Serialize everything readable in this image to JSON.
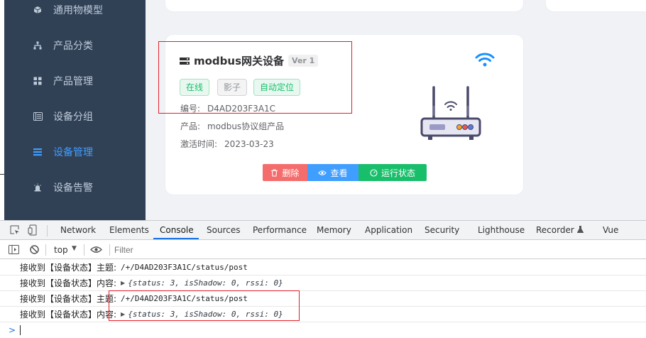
{
  "sidebar": {
    "items": [
      {
        "label": "通用物模型",
        "icon": "cube-icon",
        "active": false
      },
      {
        "label": "产品分类",
        "icon": "tree-icon",
        "active": false
      },
      {
        "label": "产品管理",
        "icon": "grid-icon",
        "active": false
      },
      {
        "label": "设备分组",
        "icon": "list-icon",
        "active": false
      },
      {
        "label": "设备管理",
        "icon": "device-list-icon",
        "active": true
      },
      {
        "label": "设备告警",
        "icon": "alarm-icon",
        "active": false
      }
    ]
  },
  "device_card": {
    "title": "modbus网关设备",
    "version": "Ver 1",
    "tags": [
      "在线",
      "影子",
      "自动定位"
    ],
    "serial_label": "编号:",
    "serial_value": "D4AD203F3A1C",
    "product_label": "产品:",
    "product_value": "modbus协议组产品",
    "activated_label": "激活时间:",
    "activated_value": "2023-03-23",
    "buttons": {
      "delete": "删除",
      "view": "查看",
      "status": "运行状态"
    }
  },
  "devtools": {
    "tabs": [
      "Network",
      "Elements",
      "Console",
      "Sources",
      "Performance",
      "Memory",
      "Application",
      "Security",
      "Lighthouse",
      "Recorder",
      "Vue"
    ],
    "active_tab": "Console",
    "context": "top",
    "filter_placeholder": "Filter",
    "logs": [
      {
        "label": "接收到【设备状态】主题:",
        "value": "/+/D4AD203F3A1C/status/post",
        "type": "string"
      },
      {
        "label": "接收到【设备状态】内容:",
        "value": "{status: 3, isShadow: 0, rssi: 0}",
        "type": "object"
      },
      {
        "label": "接收到【设备状态】主题:",
        "value": "/+/D4AD203F3A1C/status/post",
        "type": "string"
      },
      {
        "label": "接收到【设备状态】内容:",
        "value": "{status: 3, isShadow: 0, rssi: 0}",
        "type": "object"
      }
    ],
    "prompt": ">"
  },
  "colors": {
    "sidebar_bg": "#304156",
    "active": "#409eff",
    "danger": "#f56c6c",
    "primary": "#409eff",
    "success": "#19be6b",
    "highlight_box": "#e0202a"
  }
}
